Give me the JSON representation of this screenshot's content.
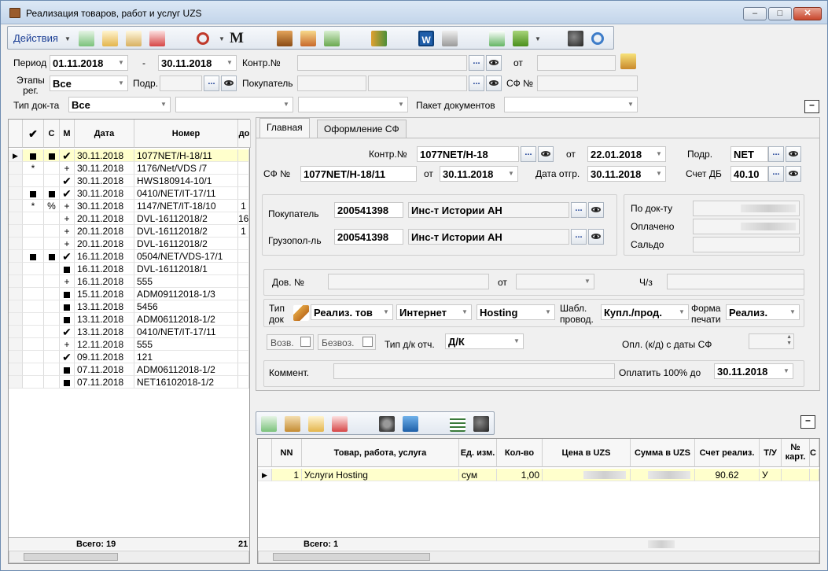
{
  "window": {
    "title": "Реализация товаров, работ и услуг UZS"
  },
  "toolbar": {
    "actions_label": "Действия",
    "icons": [
      "add-icon",
      "import-icon",
      "edit-icon",
      "delete-icon",
      "refresh-icon",
      "m-icon",
      "book-icon",
      "folder-icon",
      "money-icon",
      "arrows-icon",
      "word-icon",
      "print-icon",
      "approve-icon",
      "tree-icon",
      "binoculars-icon",
      "sync-icon"
    ]
  },
  "filters": {
    "period_label": "Период",
    "period_from": "01.11.2018",
    "dash": "-",
    "period_to": "30.11.2018",
    "contract_label": "Контр.№",
    "from_label": "от",
    "stages_label": "Этапы\nрег.",
    "stages_value": "Все",
    "subdiv_label": "Подр.",
    "buyer_label": "Покупатель",
    "sf_label": "СФ №",
    "doctype_label": "Тип док-та",
    "doctype_value": "Все",
    "package_label": "Пакет документов",
    "ellipsis": "..."
  },
  "list": {
    "headers": [
      "",
      "С",
      "М",
      "Дата",
      "Номер",
      "до"
    ],
    "rows": [
      {
        "a": "sq",
        "c": "sq",
        "m": "✔",
        "date": "30.11.2018",
        "num": "1077NET/H-18/11",
        "x": "",
        "sel": true
      },
      {
        "a": "*",
        "c": "",
        "m": "+",
        "date": "30.11.2018",
        "num": "1176/Net/VDS /7",
        "x": ""
      },
      {
        "a": "",
        "c": "",
        "m": "✔",
        "date": "30.11.2018",
        "num": " HWS180914-10/1",
        "x": ""
      },
      {
        "a": "sq",
        "c": "sq",
        "m": "✔",
        "date": "30.11.2018",
        "num": "0410/NET/IT-17/11",
        "x": ""
      },
      {
        "a": "*",
        "c": "%",
        "m": "+",
        "date": "30.11.2018",
        "num": "1147/NET/IT-18/10",
        "x": "1"
      },
      {
        "a": "",
        "c": "",
        "m": "+",
        "date": "20.11.2018",
        "num": "DVL-16112018/2",
        "x": "16"
      },
      {
        "a": "",
        "c": "",
        "m": "+",
        "date": "20.11.2018",
        "num": "DVL-16112018/2",
        "x": "1"
      },
      {
        "a": "",
        "c": "",
        "m": "+",
        "date": "20.11.2018",
        "num": "DVL-16112018/2",
        "x": ""
      },
      {
        "a": "sq",
        "c": "sq",
        "m": "✔",
        "date": "16.11.2018",
        "num": "0504/NET/VDS-17/1",
        "x": ""
      },
      {
        "a": "",
        "c": "",
        "m": "sq",
        "date": "16.11.2018",
        "num": "DVL-16112018/1",
        "x": ""
      },
      {
        "a": "",
        "c": "",
        "m": "+",
        "date": "16.11.2018",
        "num": "555",
        "x": ""
      },
      {
        "a": "",
        "c": "",
        "m": "sq",
        "date": "15.11.2018",
        "num": "ADM09112018-1/3",
        "x": ""
      },
      {
        "a": "",
        "c": "",
        "m": "sq",
        "date": "13.11.2018",
        "num": "5456",
        "x": ""
      },
      {
        "a": "",
        "c": "",
        "m": "sq",
        "date": "13.11.2018",
        "num": "ADM06112018-1/2",
        "x": ""
      },
      {
        "a": "",
        "c": "",
        "m": "✔",
        "date": "13.11.2018",
        "num": "0410/NET/IT-17/11",
        "x": ""
      },
      {
        "a": "",
        "c": "",
        "m": "+",
        "date": "12.11.2018",
        "num": "555",
        "x": ""
      },
      {
        "a": "",
        "c": "",
        "m": "✔",
        "date": "09.11.2018",
        "num": "121",
        "x": ""
      },
      {
        "a": "",
        "c": "",
        "m": "sq",
        "date": "07.11.2018",
        "num": "ADM06112018-1/2",
        "x": ""
      },
      {
        "a": "",
        "c": "",
        "m": "sq",
        "date": "07.11.2018",
        "num": "NET16102018-1/2",
        "x": ""
      }
    ],
    "total_label": "Всего: 19",
    "total_right": "21"
  },
  "detail": {
    "tabs": [
      "Главная",
      "Оформление СФ"
    ],
    "contract_label": "Контр.№",
    "contract_value": "1077NET/H-18",
    "from_label": "от",
    "contract_date": "22.01.2018",
    "subdiv_label": "Подр.",
    "subdiv_value": "NET",
    "sf_label": "СФ №",
    "sf_value": "1077NET/H-18/11",
    "sf_date": "30.11.2018",
    "ship_label": "Дата отгр.",
    "ship_date": "30.11.2018",
    "account_label": "Счет ДБ",
    "account_value": "40.10",
    "buyer_label": "Покупатель",
    "buyer_code": "200541398",
    "buyer_name": "Инс-т Истории АН",
    "consignee_label": "Грузопол-ль",
    "consignee_code": "200541398",
    "consignee_name": "Инс-т Истории АН",
    "by_doc_label": "По док-ту",
    "paid_label": "Оплачено",
    "balance_label": "Сальдо",
    "power_label": "Дов. №",
    "via_label": "Ч/з",
    "doctype_label": "Тип\nдок",
    "doctype_value": "Реализ. тов",
    "channel_value": "Интернет",
    "service_value": "Hosting",
    "template_label": "Шабл.\nпровод.",
    "template_value": "Купл./прод.",
    "printform_label": "Форма\nпечати",
    "printform_value": "Реализ.",
    "return_label": "Возв.",
    "free_label": "Безвоз.",
    "dk_label": "Тип д/к отч.",
    "dk_value": "Д/К",
    "payment_label": "Опл. (к/д) с даты СФ",
    "comment_label": "Коммент.",
    "pay100_label": "Оплатить 100% до",
    "pay100_date": "30.11.2018"
  },
  "items": {
    "headers": [
      "NN",
      "Товар, работа, услуга",
      "Ед. изм.",
      "Кол-во",
      "Цена в UZS",
      "Сумма в UZS",
      "Счет реализ.",
      "Т/У",
      "№\nкарт.",
      "С"
    ],
    "rows": [
      {
        "nn": "1",
        "name": "Услуги Hosting",
        "unit": "сум",
        "qty": "1,00",
        "price": "",
        "sum": "",
        "account": "90.62",
        "tu": "У",
        "card": ""
      }
    ],
    "total_label": "Всего: 1"
  }
}
